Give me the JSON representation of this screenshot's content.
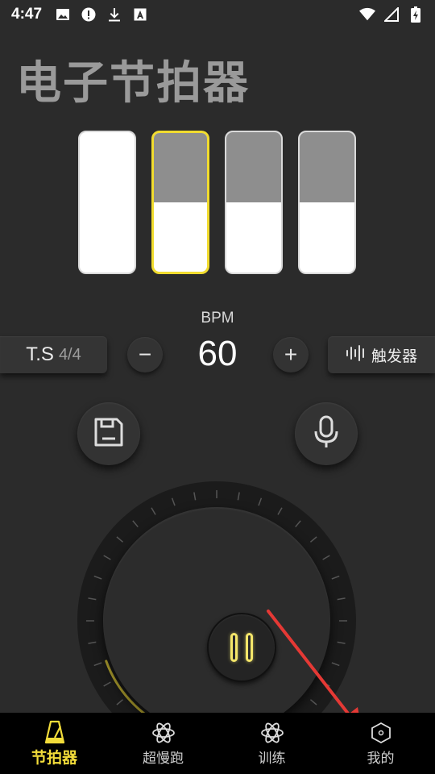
{
  "status_bar": {
    "time": "4:47",
    "icons_left": [
      "image-icon",
      "alert-icon",
      "download-icon",
      "font-icon"
    ],
    "icons_right": [
      "wifi-icon",
      "signal-icon",
      "battery-icon"
    ]
  },
  "app": {
    "title": "电子节拍器"
  },
  "beats": [
    {
      "level": 1.0,
      "active": false
    },
    {
      "level": 0.5,
      "active": true
    },
    {
      "level": 0.5,
      "active": false
    },
    {
      "level": 0.5,
      "active": false
    }
  ],
  "controls": {
    "bpm_label": "BPM",
    "bpm_value": "60",
    "ts_label": "T.S",
    "ts_value": "4/4",
    "minus_label": "−",
    "plus_label": "+",
    "trigger_label": "触发器"
  },
  "colors": {
    "accent": "#f2dc3a",
    "background": "#2b2b2b",
    "nav_background": "#000000"
  },
  "nav": {
    "items": [
      {
        "label": "节拍器",
        "icon": "metronome-icon",
        "active": true
      },
      {
        "label": "超慢跑",
        "icon": "atom-icon",
        "active": false
      },
      {
        "label": "训练",
        "icon": "atom-icon",
        "active": false
      },
      {
        "label": "我的",
        "icon": "hexagon-icon",
        "active": false
      }
    ]
  }
}
